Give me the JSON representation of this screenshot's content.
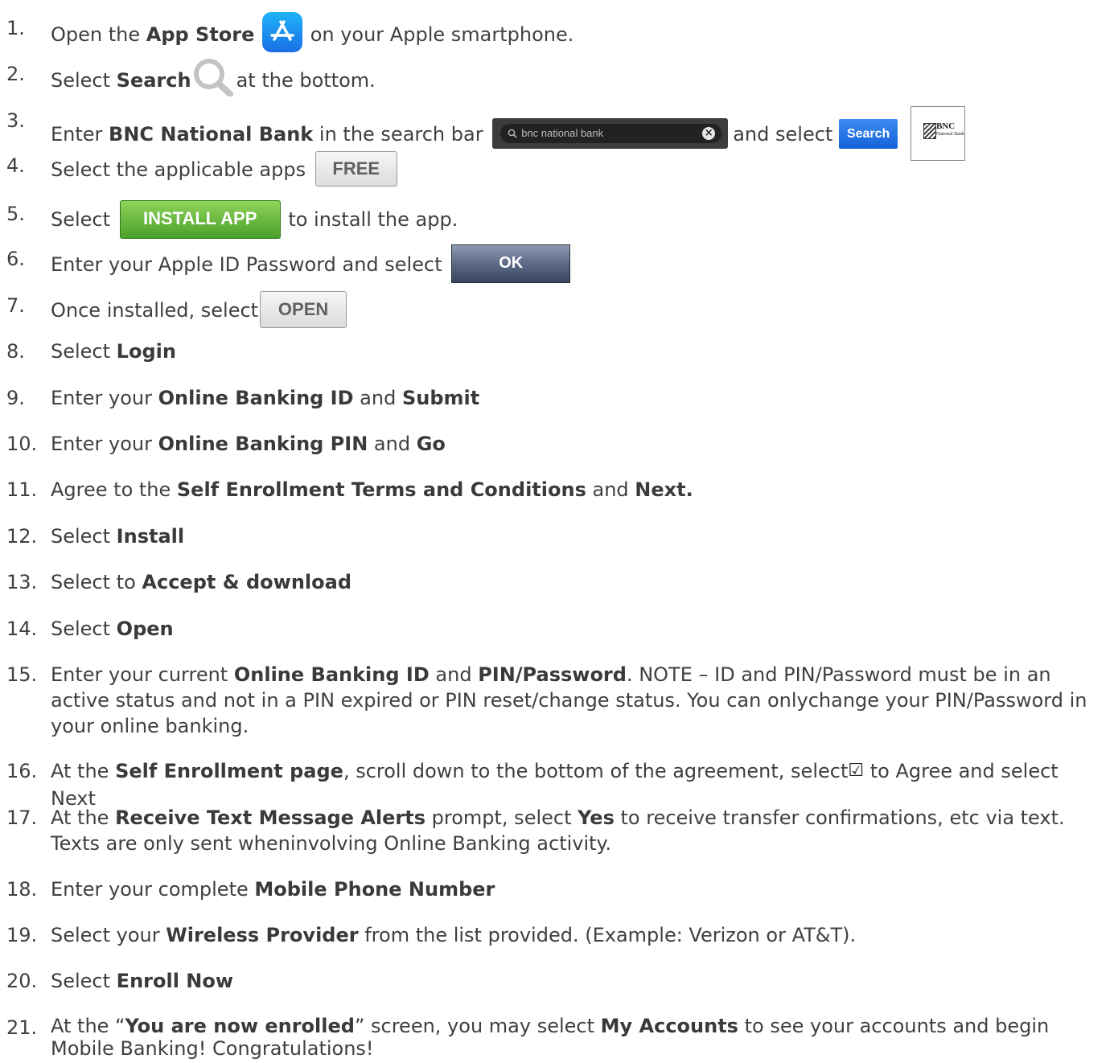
{
  "steps": [
    {
      "num": "1.",
      "a": "Open the ",
      "b": "App Store",
      "c": " on your Apple smartphone."
    },
    {
      "num": "2.",
      "a": "Select ",
      "b": "Search",
      "c": "at the bottom."
    },
    {
      "num": "3.",
      "a": "Enter ",
      "b": "BNC National Bank",
      "c": " in the search bar",
      "d": "and select"
    },
    {
      "num": "4.",
      "a": "Select the applicable apps"
    },
    {
      "num": "5.",
      "a": "Select",
      "c": "to install the app."
    },
    {
      "num": "6.",
      "a": "Enter your Apple ID Password and select"
    },
    {
      "num": "7.",
      "a": "Once installed, select"
    },
    {
      "num": "8.",
      "a": "Select ",
      "b": "Login"
    },
    {
      "num": "9.",
      "a": "Enter your ",
      "b": "Online Banking ID",
      "c": " and ",
      "d": "Submit"
    },
    {
      "num": "10.",
      "a": "Enter your ",
      "b": "Online Banking PIN",
      "c": " and ",
      "d": "Go"
    },
    {
      "num": "11.",
      "a": "Agree to the ",
      "b": "Self Enrollment Terms and Conditions",
      "c": " and ",
      "d": "Next."
    },
    {
      "num": "12.",
      "a": "Select ",
      "b": "Install"
    },
    {
      "num": "13.",
      "a": "Select to ",
      "b": "Accept & download"
    },
    {
      "num": "14.",
      "a": "Select ",
      "b": "Open"
    },
    {
      "num": "15.",
      "a": "Enter your current ",
      "b": "Online Banking ID",
      "c": " and ",
      "d": "PIN/Password",
      "e": ". NOTE – ID and PIN/Password must be in an active status and not in a PIN expired or PIN reset/change status. You can onlychange your PIN/Password in your online banking."
    },
    {
      "num": "16.",
      "a": "At the ",
      "b": "Self Enrollment page",
      "c": ", scroll down to the bottom of the agreement, select",
      "d": " to Agree and select Next"
    },
    {
      "num": "17.",
      "a": "At the ",
      "b": "Receive Text Message Alerts",
      "c": " prompt, select ",
      "d": "Yes",
      "e": " to receive transfer confirmations, etc via text. Texts are only sent wheninvolving Online Banking activity."
    },
    {
      "num": "18.",
      "a": "Enter your complete ",
      "b": "Mobile Phone Number"
    },
    {
      "num": "19.",
      "a": "Select your ",
      "b": "Wireless Provider",
      "c": " from the list provided. (Example: Verizon or AT&T)."
    },
    {
      "num": "20.",
      "a": "Select ",
      "b": "Enroll Now"
    },
    {
      "num": "21.",
      "a": "At the “",
      "b": "You are now enrolled",
      "c": "” screen, you may select ",
      "d": "My Accounts",
      "e": " to see your accounts and begin Mobile Banking! Congratulations!"
    }
  ],
  "ui": {
    "search_placeholder": "bnc national bank",
    "search_button": "Search",
    "bnc_logo_line1": "BNC",
    "bnc_logo_line2": "National Bank",
    "free_button": "FREE",
    "install_button": "INSTALL APP",
    "ok_button": "OK",
    "open_button": "OPEN"
  },
  "icons": {
    "app_store": "app-store-icon",
    "search": "magnifier-icon",
    "checkbox": "checkbox-icon"
  }
}
